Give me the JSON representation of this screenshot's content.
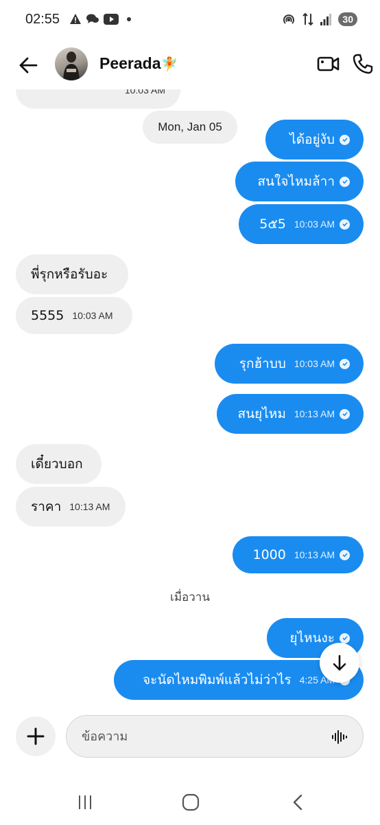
{
  "status": {
    "time": "02:55",
    "battery": "30"
  },
  "header": {
    "contact_name": "Peerada",
    "contact_emoji": "🧚"
  },
  "chat": {
    "partial_time": "10:03 AM",
    "date_chip": "Mon, Jan 05",
    "messages": [
      {
        "text": "ได้อยู่งับ",
        "time": ""
      },
      {
        "text": "สนใจไหมล้าา",
        "time": ""
      },
      {
        "text": "5๕5",
        "time": "10:03 AM"
      },
      {
        "text": "พี่รุกหรือรับอะ",
        "time": ""
      },
      {
        "text": "5555",
        "time": "10:03 AM"
      },
      {
        "text": "รุกฮ้าบบ",
        "time": "10:03 AM"
      },
      {
        "text": "สนยุไหม",
        "time": "10:13 AM"
      },
      {
        "text": "เดี๋ยวบอก",
        "time": ""
      },
      {
        "text": "ราคา",
        "time": "10:13 AM"
      },
      {
        "text": "1000",
        "time": "10:13 AM"
      },
      {
        "text": "ยุไหนงะ",
        "time": ""
      },
      {
        "text": "จะนัดไหมพิมพ์แล้วไม่ว่าไร",
        "time": "4:25 AM"
      }
    ],
    "day_label": "เมื่อวาน"
  },
  "composer": {
    "placeholder": "ข้อความ"
  },
  "colors": {
    "outgoing": "#1a8cf0",
    "incoming": "#efefef"
  }
}
